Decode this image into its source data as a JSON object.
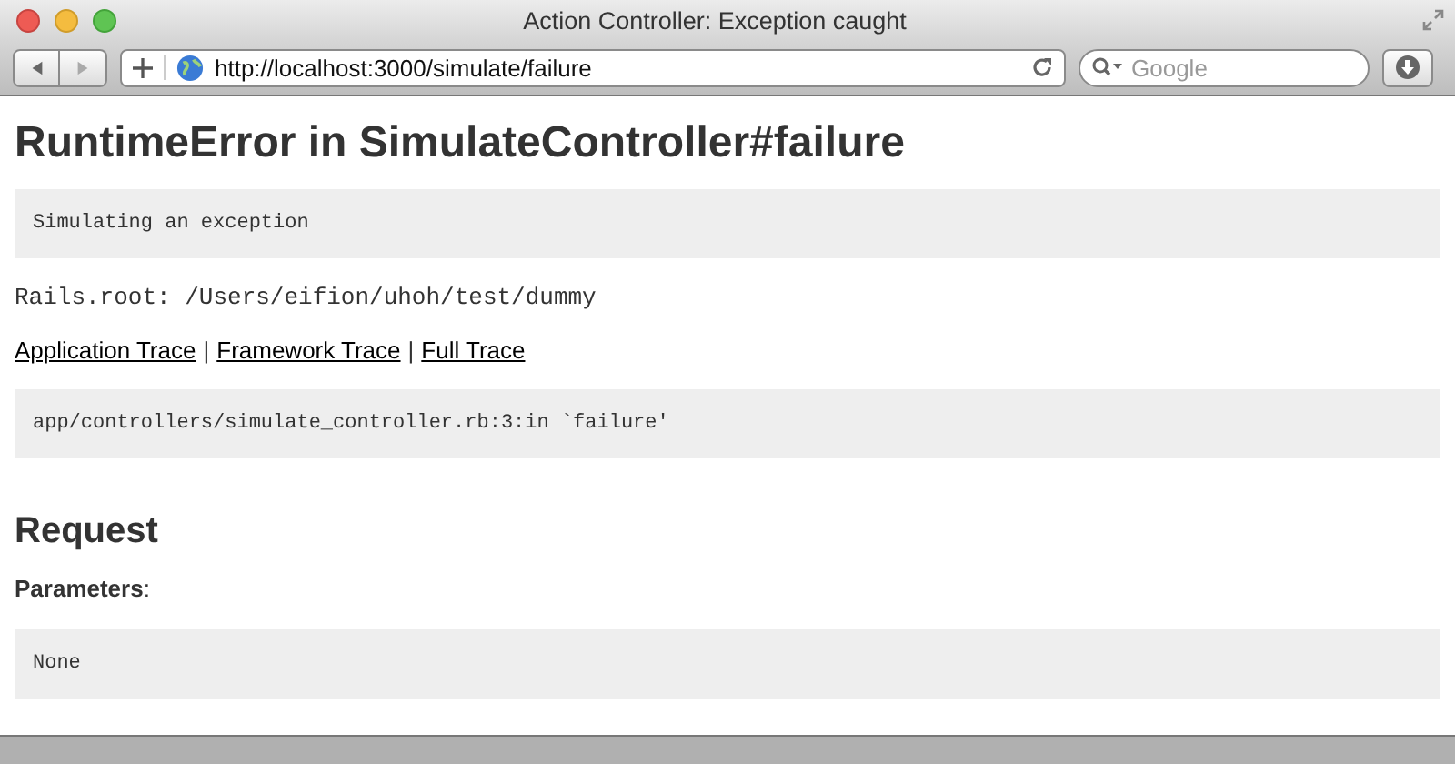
{
  "window": {
    "title": "Action Controller: Exception caught"
  },
  "toolbar": {
    "url": "http://localhost:3000/simulate/failure",
    "search_placeholder": "Google"
  },
  "page": {
    "heading": "RuntimeError in SimulateController#failure",
    "message": "Simulating an exception",
    "rails_root": "Rails.root: /Users/eifion/uhoh/test/dummy",
    "trace_links": [
      "Application Trace",
      "Framework Trace",
      "Full Trace"
    ],
    "trace_separator": "|",
    "trace": "app/controllers/simulate_controller.rb:3:in `failure'",
    "request_heading": "Request",
    "parameters_label": "Parameters",
    "parameters_colon": ":",
    "parameters_value": "None"
  }
}
